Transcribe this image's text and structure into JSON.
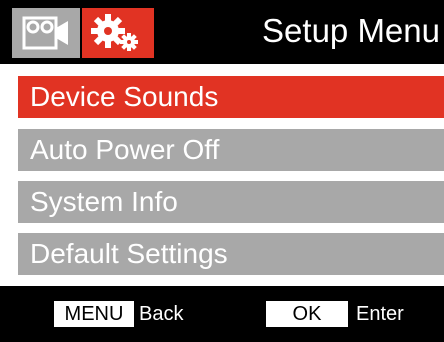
{
  "header": {
    "title": "Setup Menu",
    "tabs": [
      {
        "icon": "video-camera-icon",
        "active": false
      },
      {
        "icon": "gears-icon",
        "active": true
      }
    ]
  },
  "menu": {
    "items": [
      {
        "label": "Device Sounds",
        "selected": true
      },
      {
        "label": "Auto Power Off",
        "selected": false
      },
      {
        "label": "System Info",
        "selected": false
      },
      {
        "label": "Default Settings",
        "selected": false
      }
    ]
  },
  "footer": {
    "menu_key": "MENU",
    "menu_action": "Back",
    "ok_key": "OK",
    "ok_action": "Enter"
  },
  "colors": {
    "accent": "#e13323",
    "item_bg": "#a8a8a8",
    "menu_bg": "#ffffff",
    "frame_bg": "#000000",
    "text": "#ffffff"
  }
}
